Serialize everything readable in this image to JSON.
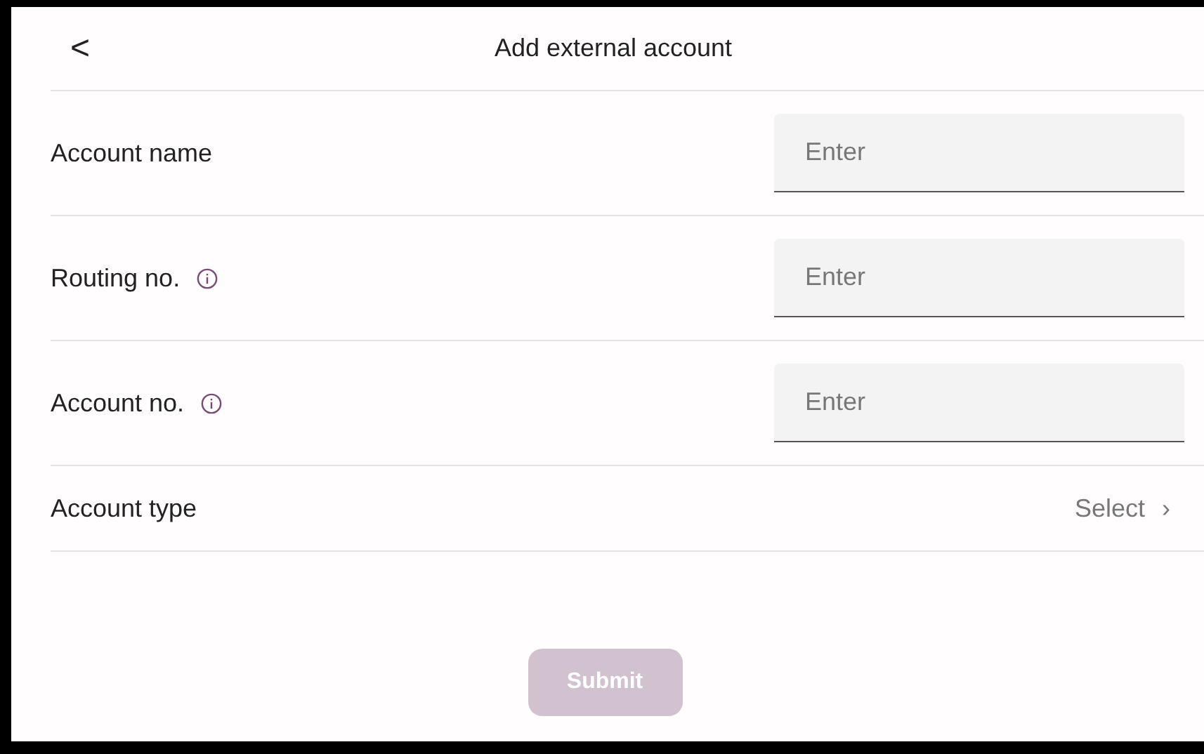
{
  "header": {
    "back": "<",
    "title": "Add external account"
  },
  "fields": [
    {
      "kind": "input",
      "label": "Account name",
      "info": false,
      "placeholder": "Enter"
    },
    {
      "kind": "input",
      "label": "Routing no.",
      "info": true,
      "placeholder": "Enter"
    },
    {
      "kind": "input",
      "label": "Account no.",
      "info": true,
      "placeholder": "Enter"
    },
    {
      "kind": "select",
      "label": "Account type",
      "info": false,
      "value": "Select",
      "chevron": "›"
    }
  ],
  "submit": {
    "label": "Submit",
    "disabled": true
  }
}
